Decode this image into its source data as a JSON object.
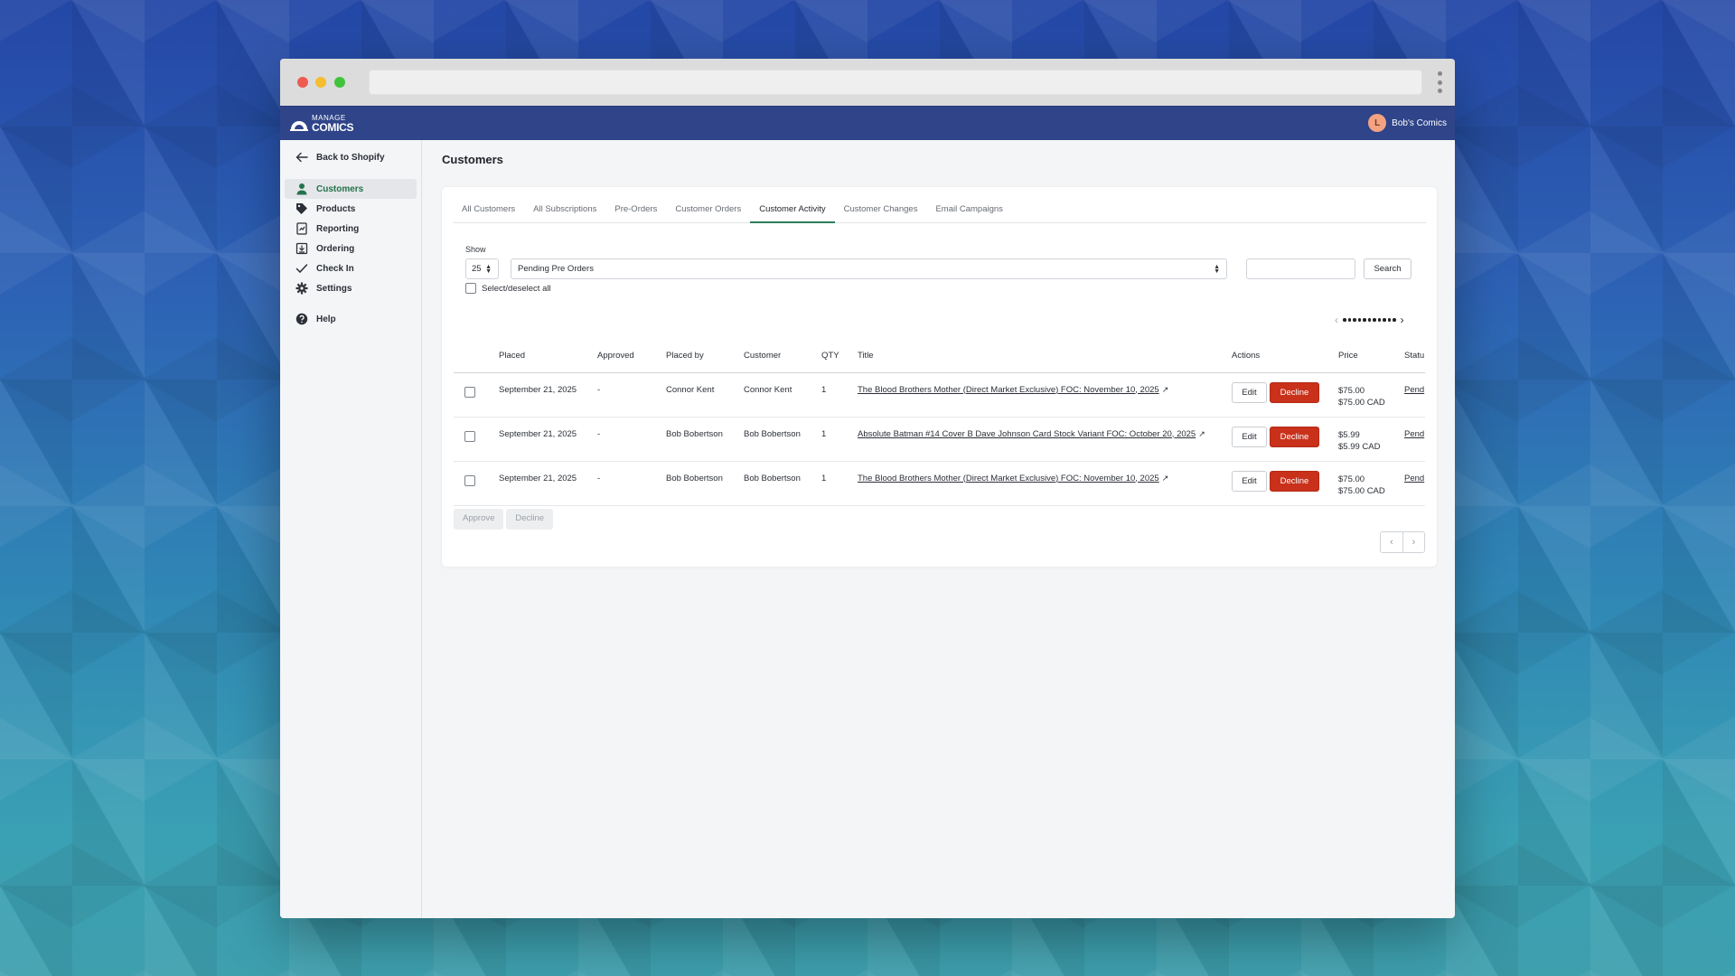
{
  "app": {
    "logo": {
      "top": "MANAGE",
      "bottom": "COMICS"
    },
    "user": {
      "initial": "L",
      "name": "Bob's Comics"
    }
  },
  "sidebar": {
    "back_label": "Back to Shopify",
    "items": [
      {
        "label": "Customers",
        "icon": "person-icon",
        "active": true
      },
      {
        "label": "Products",
        "icon": "tag-icon"
      },
      {
        "label": "Reporting",
        "icon": "report-icon"
      },
      {
        "label": "Ordering",
        "icon": "download-box-icon"
      },
      {
        "label": "Check In",
        "icon": "checkmark-icon"
      },
      {
        "label": "Settings",
        "icon": "gear-icon"
      }
    ],
    "help_label": "Help"
  },
  "page": {
    "title": "Customers",
    "tabs": [
      "All Customers",
      "All Subscriptions",
      "Pre-Orders",
      "Customer Orders",
      "Customer Activity",
      "Customer Changes",
      "Email Campaigns"
    ],
    "active_tab": "Customer Activity",
    "show_label": "Show",
    "page_size": "25",
    "filter_value": "Pending Pre Orders",
    "search_placeholder": "",
    "search_label": "Search",
    "select_all_label": "Select/deselect all"
  },
  "table": {
    "columns": [
      "Placed",
      "Approved",
      "Placed by",
      "Customer",
      "QTY",
      "Title",
      "Actions",
      "Price",
      "Statu"
    ],
    "rows": [
      {
        "placed": "September 21, 2025",
        "approved": "-",
        "placed_by": "Connor Kent",
        "customer": "Connor Kent",
        "qty": "1",
        "title": "The Blood Brothers Mother (Direct Market Exclusive) FOC: November 10, 2025",
        "price": "$75.00",
        "price_cad": "$75.00 CAD",
        "status": "Pend"
      },
      {
        "placed": "September 21, 2025",
        "approved": "-",
        "placed_by": "Bob Bobertson",
        "customer": "Bob Bobertson",
        "qty": "1",
        "title": "Absolute Batman #14 Cover B Dave Johnson Card Stock Variant FOC: October 20, 2025",
        "price": "$5.99",
        "price_cad": "$5.99 CAD",
        "status": "Pend"
      },
      {
        "placed": "September 21, 2025",
        "approved": "-",
        "placed_by": "Bob Bobertson",
        "customer": "Bob Bobertson",
        "qty": "1",
        "title": "The Blood Brothers Mother (Direct Market Exclusive) FOC: November 10, 2025",
        "price": "$75.00",
        "price_cad": "$75.00 CAD",
        "status": "Pend"
      }
    ],
    "edit_label": "Edit",
    "decline_label": "Decline"
  },
  "bulk": {
    "approve_label": "Approve",
    "decline_label": "Decline"
  },
  "colors": {
    "accent": "#2c7d59",
    "topbar": "#2f4489",
    "decline": "#c9311b"
  }
}
